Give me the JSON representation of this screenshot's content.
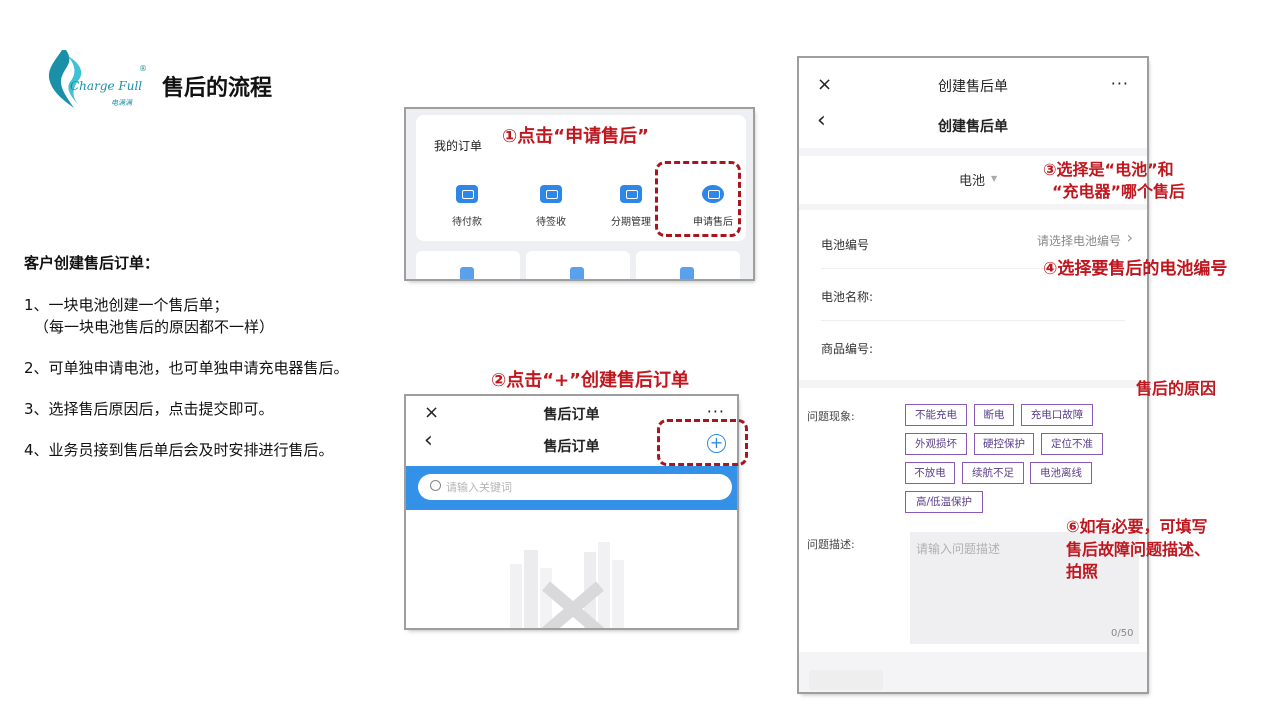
{
  "header": {
    "title": "售后的流程",
    "logo_text": "Charge Full",
    "logo_sub": "电满满",
    "logo_reg": "®"
  },
  "intro": {
    "subtitle": "客户创建售后订单：",
    "steps": [
      "1、一块电池创建一个售后单；",
      "（每一块电池售后的原因都不一样）",
      "2、可单独申请电池，也可单独申请充电器售后。",
      "3、选择售后原因后，点击提交即可。",
      "4、业务员接到售后单后会及时安排进行售后。"
    ]
  },
  "annotations": {
    "a1": "①点击“申请售后”",
    "a2": "②点击“+”创建售后订单",
    "a3_line1": "③选择是“电池”和",
    "a3_line2": "“充电器”哪个售后",
    "a4": "④选择要售后的电池编号",
    "a5": "售后的原因",
    "a6_line1": "⑥如有必要，可填写",
    "a6_line2": "售后故障问题描述、",
    "a6_line3": "拍照"
  },
  "my_orders": {
    "title": "我的订单",
    "items": [
      "待付款",
      "待签收",
      "分期管理",
      "申请售后"
    ]
  },
  "after_sales_list": {
    "close": "×",
    "top_title": "售后订单",
    "more": "···",
    "back": "‹",
    "title": "售后订单",
    "plus": "+",
    "search_placeholder": "请输入关键词"
  },
  "create_form": {
    "close": "×",
    "top_title": "创建售后单",
    "more": "···",
    "back": "‹",
    "title": "创建售后单",
    "type_value": "电池",
    "battery_no_label": "电池编号",
    "battery_no_placeholder": "请选择电池编号",
    "battery_name_label": "电池名称:",
    "product_no_label": "商品编号:",
    "issue_label": "问题现象:",
    "tags": [
      "不能充电",
      "断电",
      "充电口故障",
      "外观损坏",
      "硬控保护",
      "定位不准",
      "不放电",
      "续航不足",
      "电池离线",
      "高/低温保护"
    ],
    "desc_label": "问题描述:",
    "desc_placeholder": "请输入问题描述",
    "desc_count": "0/50"
  },
  "colors": {
    "accent_red": "#c0161e",
    "brand_teal": "#1a8fa8",
    "app_blue": "#3391e8",
    "tag_border": "#8a5ab8"
  }
}
